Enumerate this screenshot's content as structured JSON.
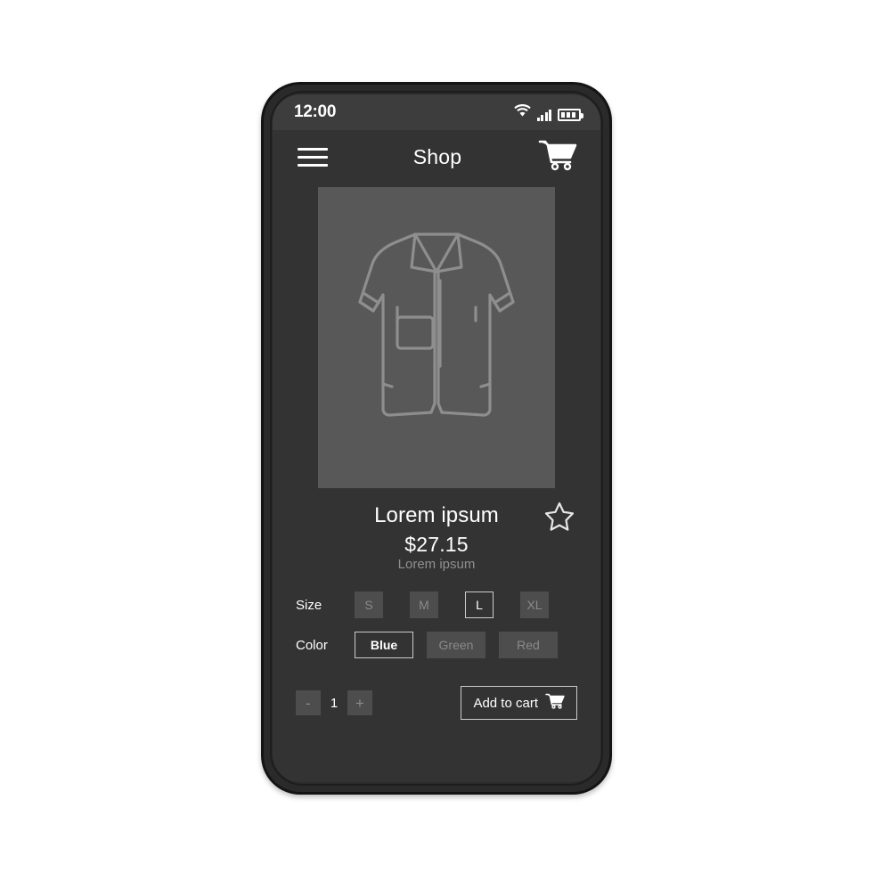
{
  "status_bar": {
    "time": "12:00",
    "wifi_icon": "wifi-icon",
    "signal_icon": "signal-bars-icon",
    "battery_icon": "battery-icon"
  },
  "header": {
    "menu_icon": "hamburger-menu-icon",
    "title": "Shop",
    "cart_icon": "shopping-cart-icon"
  },
  "product": {
    "image_icon": "shirt-illustration",
    "title": "Lorem ipsum",
    "price": "$27.15",
    "subtitle": "Lorem ipsum",
    "favorite_icon": "star-outline-icon"
  },
  "options": {
    "size": {
      "label": "Size",
      "values": [
        "S",
        "M",
        "L",
        "XL"
      ],
      "selected": "L"
    },
    "color": {
      "label": "Color",
      "values": [
        "Blue",
        "Green",
        "Red"
      ],
      "selected": "Blue"
    }
  },
  "actions": {
    "decrement_label": "-",
    "quantity": "1",
    "increment_label": "+",
    "add_to_cart_label": "Add to cart",
    "add_to_cart_icon": "shopping-cart-icon"
  },
  "colors": {
    "screen_bg": "#333333",
    "status_bar_bg": "#3d3d3d",
    "image_bg": "#585858",
    "chip_bg": "#4d4d4d",
    "chip_text": "#8a8a8a",
    "accent_text": "#ffffff",
    "muted_text": "#909090",
    "frame": "#2a2a2a"
  }
}
